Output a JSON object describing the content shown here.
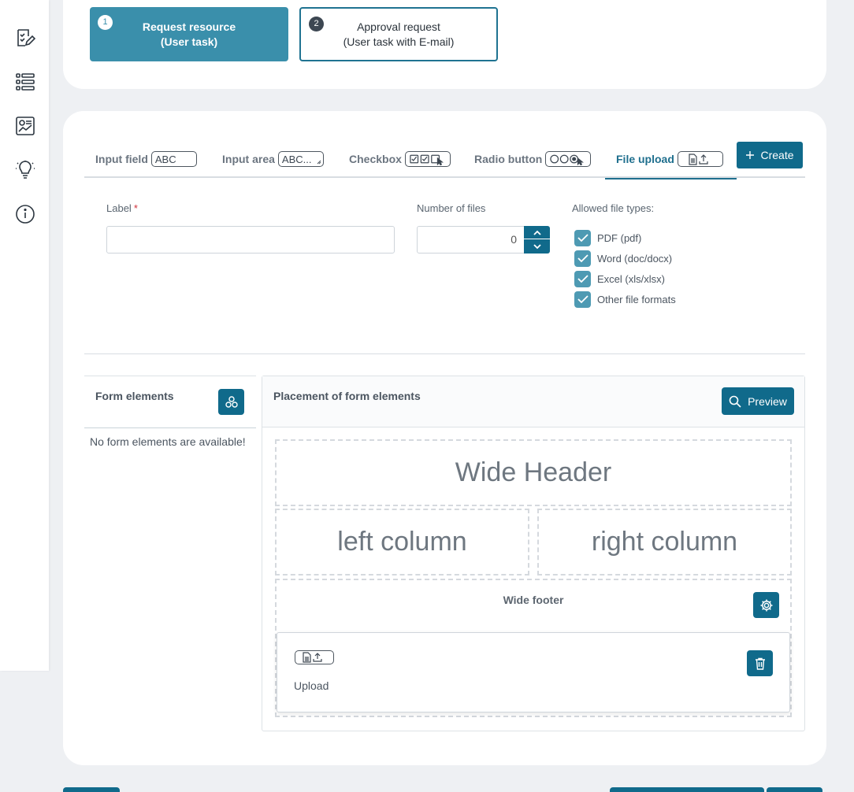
{
  "steps": [
    {
      "number": "1",
      "line1": "Request resource",
      "line2": "(User task)"
    },
    {
      "number": "2",
      "line1": "Approval request",
      "line2": "(User task with E-mail)"
    }
  ],
  "tabs": [
    {
      "label": "Input field",
      "badge": "ABC"
    },
    {
      "label": "Input area",
      "badge": "ABC..."
    },
    {
      "label": "Checkbox",
      "badge": ""
    },
    {
      "label": "Radio button",
      "badge": ""
    },
    {
      "label": "File upload",
      "badge": ""
    }
  ],
  "create_label": "Create",
  "form": {
    "label_field": {
      "label": "Label",
      "required_mark": "*",
      "value": ""
    },
    "number_of_files": {
      "label": "Number of files",
      "value": "0"
    },
    "allowed_types": {
      "label": "Allowed file types:",
      "options": [
        {
          "label": "PDF (pdf)",
          "checked": true
        },
        {
          "label": "Word (doc/docx)",
          "checked": true
        },
        {
          "label": "Excel (xls/xlsx)",
          "checked": true
        },
        {
          "label": "Other file formats",
          "checked": true
        }
      ]
    }
  },
  "form_elements": {
    "title": "Form elements",
    "empty_text": "No form elements are available!"
  },
  "placement": {
    "title": "Placement of form elements",
    "preview_label": "Preview",
    "wide_header": "Wide Header",
    "left_column": "left column",
    "right_column": "right column",
    "wide_footer": "Wide footer",
    "upload_label": "Upload"
  },
  "colors": {
    "primary": "#106a8b",
    "step_active": "#3a8fab",
    "checkbox": "#4e9ab3"
  }
}
